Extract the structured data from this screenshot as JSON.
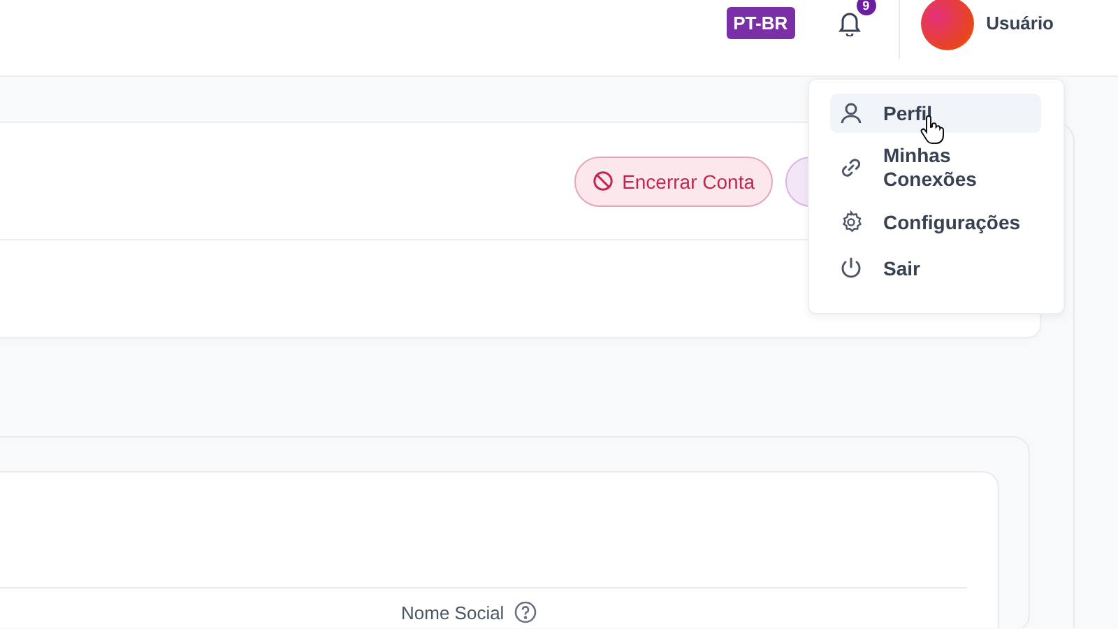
{
  "topbar": {
    "language": "PT-BR",
    "notifications": {
      "count": "9"
    },
    "user": {
      "name": "Usuário"
    }
  },
  "user_menu": {
    "items": [
      {
        "label": "Perfil",
        "selected": true
      },
      {
        "label": "Minhas Conexões",
        "selected": false
      },
      {
        "label": "Configurações",
        "selected": false
      },
      {
        "label": "Sair",
        "selected": false
      }
    ]
  },
  "account_card": {
    "buttons": [
      {
        "label": "Encerrar Conta",
        "kind": "danger"
      },
      {
        "kind": "secondary"
      }
    ]
  },
  "form_card": {
    "fields": [
      {
        "label": "Nome Social",
        "help": true
      }
    ]
  }
}
